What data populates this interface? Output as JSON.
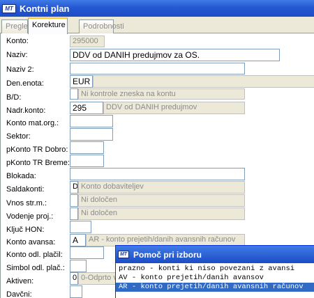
{
  "window": {
    "title": "Kontni plan",
    "logo_text": "MT"
  },
  "tabs": [
    {
      "label": "Pregled"
    },
    {
      "label": "Korekture"
    },
    {
      "label": "Podrobnosti"
    }
  ],
  "fields": {
    "konto": {
      "label": "Konto:",
      "value": "295000"
    },
    "naziv": {
      "label": "Naziv:",
      "value": "DDV od DANIH predujmov za OS."
    },
    "naziv2": {
      "label": "Naziv 2:",
      "value": ""
    },
    "den_enota": {
      "label": "Den.enota:",
      "value": "EUR"
    },
    "bd": {
      "label": "B/D:",
      "code": "",
      "desc": "Ni kontrole zneska na kontu"
    },
    "nadr_konto": {
      "label": "Nadr.konto:",
      "code": "295",
      "desc": "DDV od DANIH predujmov"
    },
    "konto_mat": {
      "label": "Konto mat.org.:",
      "value": ""
    },
    "sektor": {
      "label": "Sektor:",
      "value": ""
    },
    "pkonto_dobro": {
      "label": "pKonto TR Dobro:",
      "value": ""
    },
    "pkonto_breme": {
      "label": "pKonto TR Breme:",
      "value": ""
    },
    "blokada": {
      "label": "Blokada:",
      "value": ""
    },
    "saldakonti": {
      "label": "Saldakonti:",
      "code": "D",
      "desc": "Konto dobaviteljev"
    },
    "vnos_strm": {
      "label": "Vnos str.m.:",
      "code": "",
      "desc": "Ni določen"
    },
    "vodenje_proj": {
      "label": "Vodenje proj.:",
      "code": "",
      "desc": "Ni določen"
    },
    "kljuc_hon": {
      "label": "Ključ HON:",
      "value": ""
    },
    "konto_avansa": {
      "label": "Konto avansa:",
      "code": "A",
      "desc": "AR - konto prejetih/danih avansnih računov"
    },
    "konto_odl_placil": {
      "label": "Konto odl. plačil:",
      "value": ""
    },
    "simbol_odl": {
      "label": "Simbol odl. plač.:",
      "value": ""
    },
    "aktiven": {
      "label": "Aktiven:",
      "code": "0",
      "desc": "0-Odprto v"
    },
    "davcni": {
      "label": "Davčni:",
      "value": ""
    }
  },
  "popup": {
    "title": "Pomoč pri izboru",
    "options": [
      "prazno - konti ki niso povezani z avansi",
      "AV - konto prejetih/danih avansov",
      "AR - konto prejetih/danih avansnih računov"
    ],
    "selected_index": 2
  }
}
